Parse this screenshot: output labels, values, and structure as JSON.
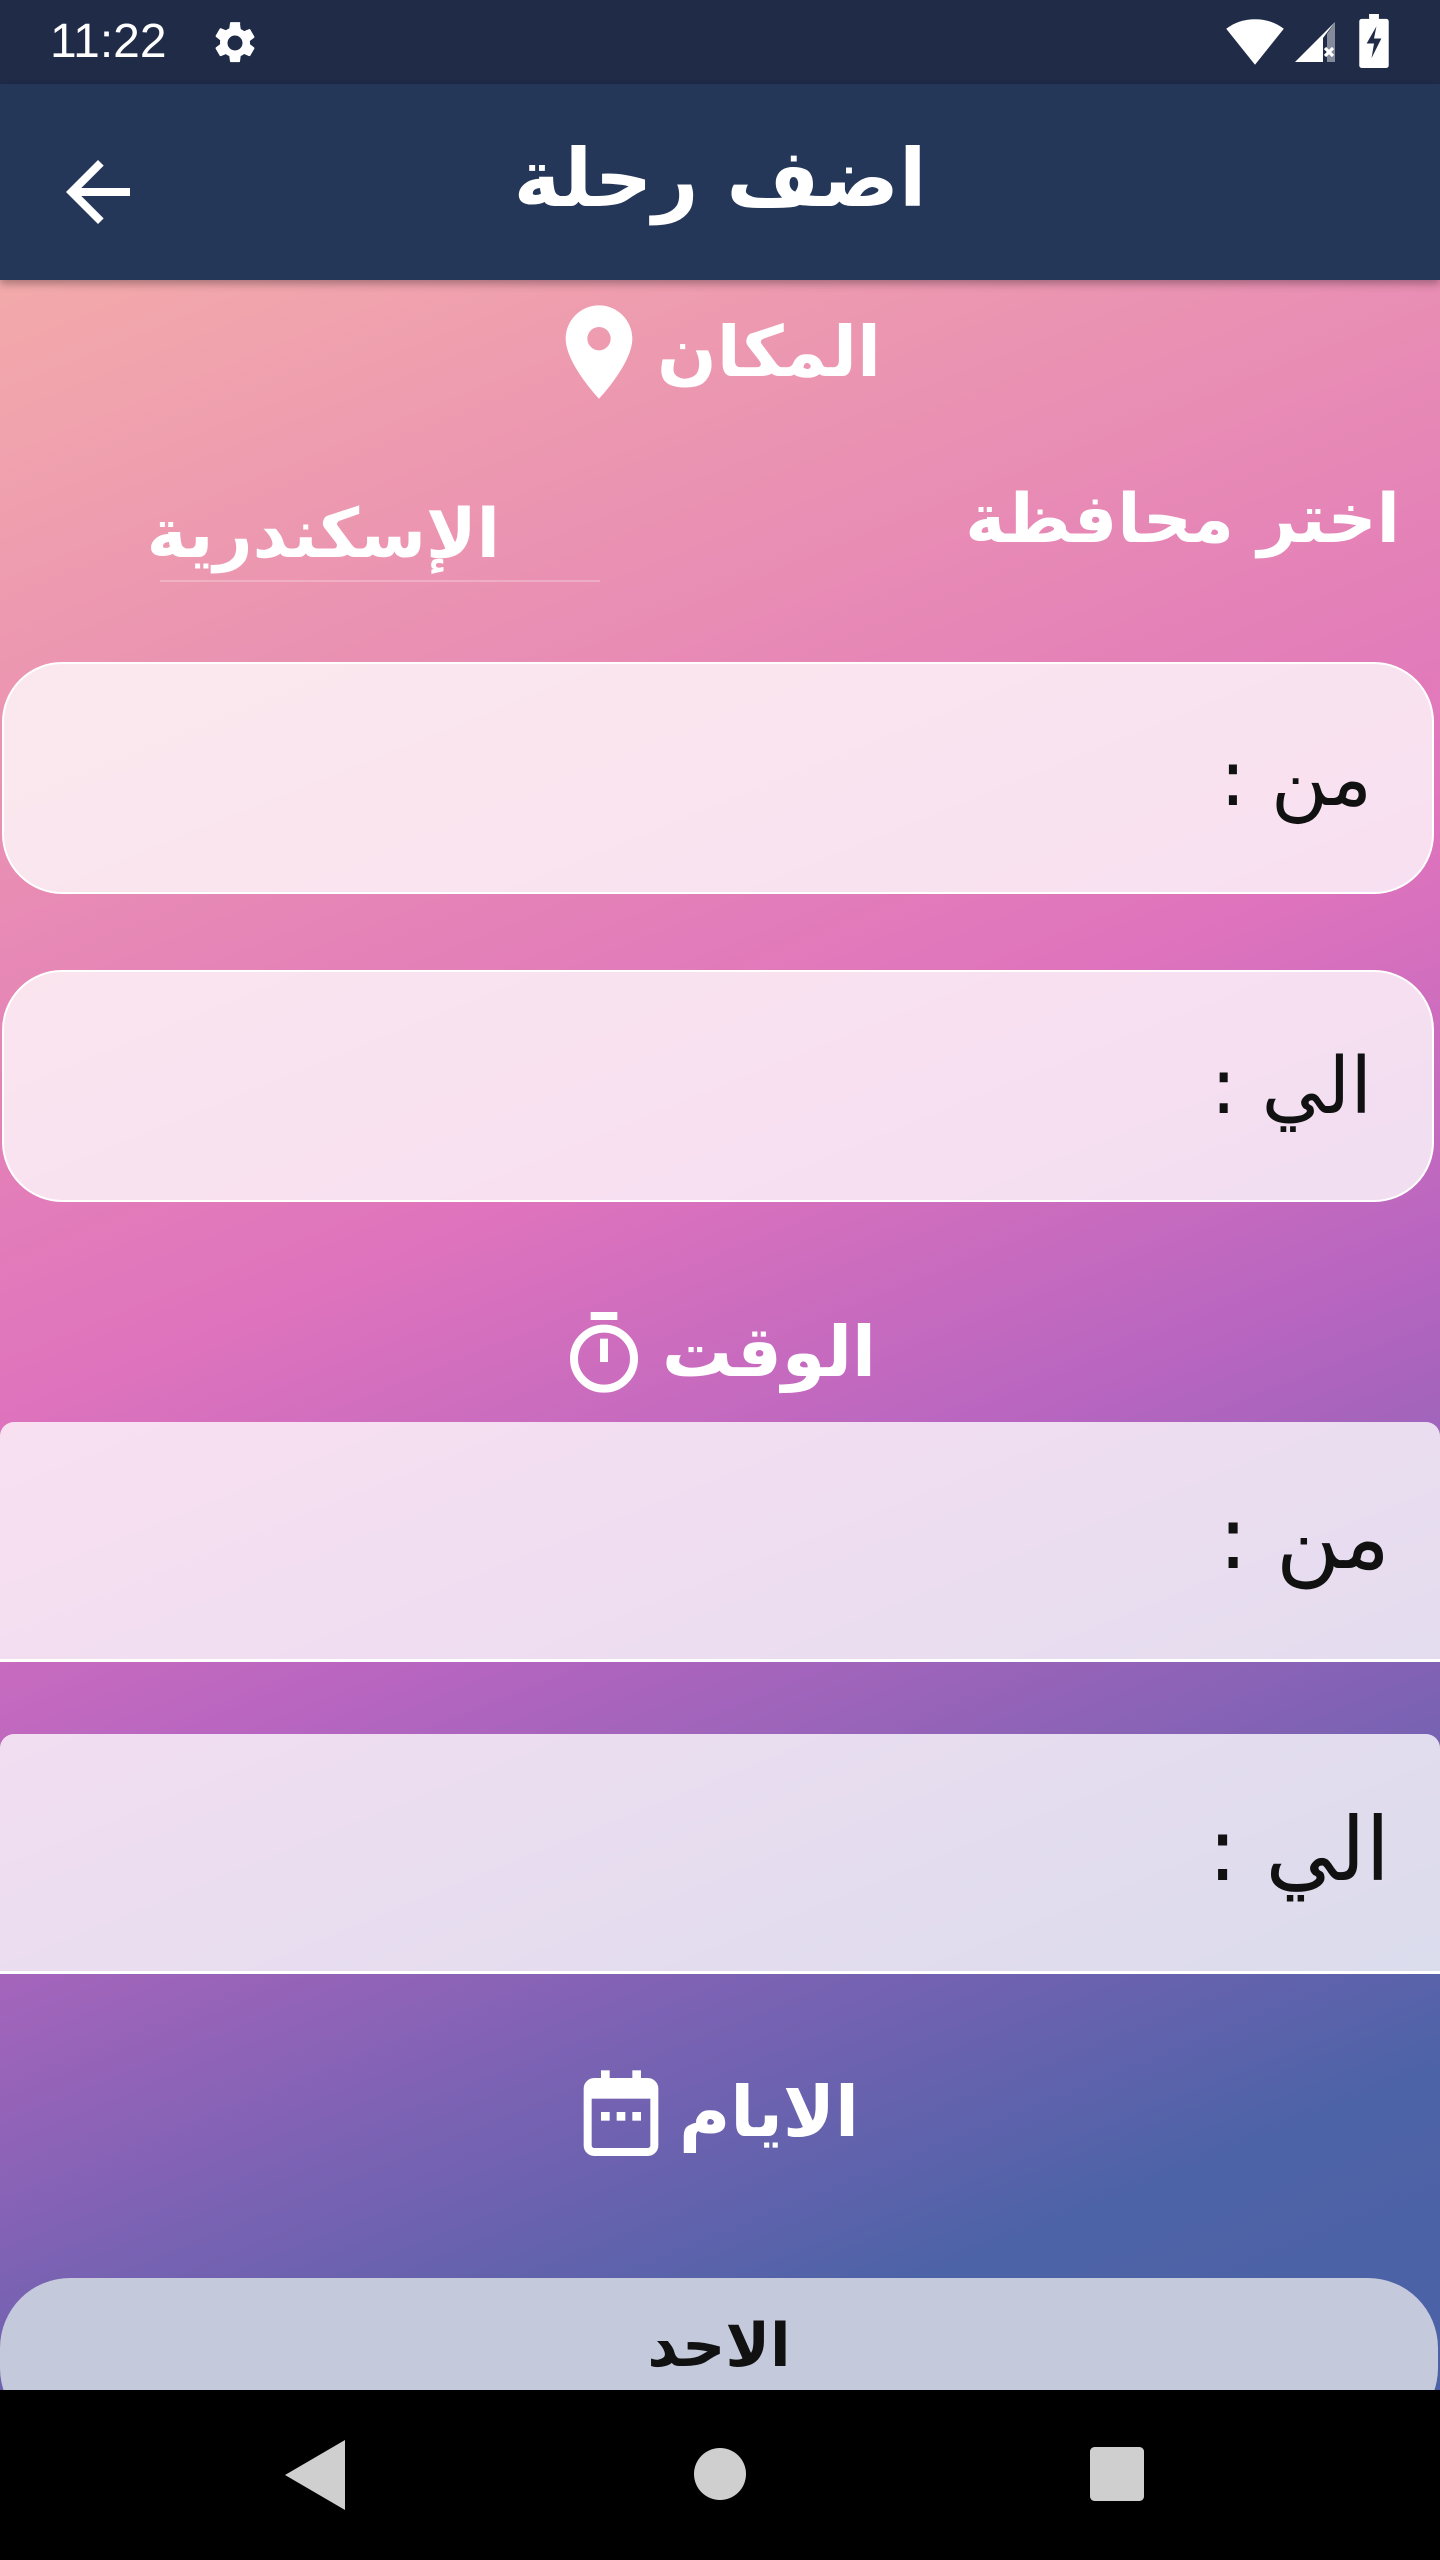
{
  "status_bar": {
    "time": "11:22",
    "icons": [
      "gear-icon",
      "wifi-icon",
      "signal-icon",
      "battery-charging-icon"
    ]
  },
  "app_bar": {
    "title": "اضف رحلة",
    "back_icon": "arrow-back-icon"
  },
  "place_section": {
    "header": "المكان",
    "icon": "location-pin-icon",
    "governorate_label": "اختر محافظة",
    "governorate_value": "الإسكندرية",
    "from_label": "من :",
    "to_label": "الي :"
  },
  "time_section": {
    "header": "الوقت",
    "icon": "timer-icon",
    "from_label": "من :",
    "to_label": "الي :"
  },
  "days_section": {
    "header": "الايام",
    "icon": "calendar-icon",
    "first_day": "الاحد"
  },
  "nav_bar": {
    "icons": [
      "nav-back-icon",
      "nav-home-icon",
      "nav-recents-icon"
    ]
  },
  "colors": {
    "status_bar": "#1f2b47",
    "app_bar": "#253759",
    "gradient_top": "#f3aaaa",
    "gradient_mid": "#df73bd",
    "gradient_bottom": "#4c62a5",
    "field_bg": "#f6dcec",
    "day_button": "#c5c9dc"
  }
}
